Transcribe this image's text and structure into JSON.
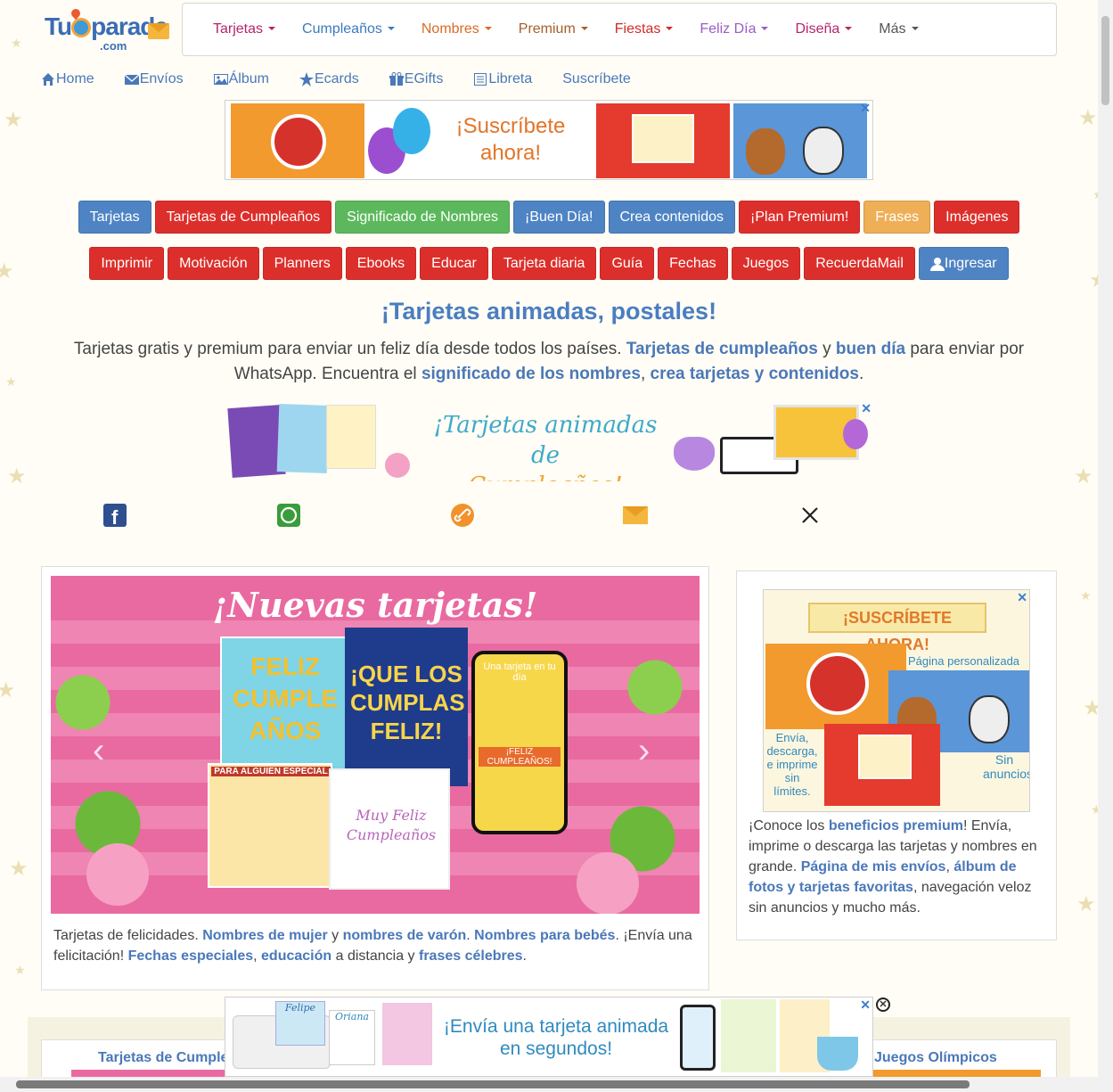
{
  "logo": {
    "text_a": "Tu",
    "text_b": "parada",
    "text_c": ".com"
  },
  "topnav": [
    {
      "label": "Tarjetas",
      "color": "#b4256e"
    },
    {
      "label": "Cumpleaños",
      "color": "#3b7bbf"
    },
    {
      "label": "Nombres",
      "color": "#d96a25"
    },
    {
      "label": "Premium",
      "color": "#a5602a"
    },
    {
      "label": "Fiestas",
      "color": "#d22b2b"
    },
    {
      "label": "Feliz Día",
      "color": "#9a5cc5"
    },
    {
      "label": "Diseña",
      "color": "#b4256e"
    },
    {
      "label": "Más",
      "color": "#555555"
    }
  ],
  "subnav": [
    {
      "label": "Home",
      "icon": "home-icon"
    },
    {
      "label": "Envíos",
      "icon": "envelope-icon"
    },
    {
      "label": "Álbum",
      "icon": "picture-icon"
    },
    {
      "label": "Ecards",
      "icon": "star-icon"
    },
    {
      "label": "EGifts",
      "icon": "gift-icon"
    },
    {
      "label": "Libreta",
      "icon": "notebook-icon"
    },
    {
      "label": "Suscríbete",
      "icon": ""
    }
  ],
  "ad_top": {
    "text": "¡Suscríbete ahora!",
    "close": "✕"
  },
  "buttons_row1": [
    {
      "label": "Tarjetas",
      "style": "blue"
    },
    {
      "label": "Tarjetas de Cumpleaños",
      "style": "red"
    },
    {
      "label": "Significado de Nombres",
      "style": "green"
    },
    {
      "label": "¡Buen Día!",
      "style": "blue"
    },
    {
      "label": "Crea contenidos",
      "style": "blue"
    },
    {
      "label": "¡Plan Premium!",
      "style": "red"
    },
    {
      "label": "Frases",
      "style": "orange"
    },
    {
      "label": "Imágenes",
      "style": "red"
    }
  ],
  "buttons_row2": [
    {
      "label": "Imprimir",
      "style": "red"
    },
    {
      "label": "Motivación",
      "style": "red"
    },
    {
      "label": "Planners",
      "style": "red"
    },
    {
      "label": "Ebooks",
      "style": "red"
    },
    {
      "label": "Educar",
      "style": "red"
    },
    {
      "label": "Tarjeta diaria",
      "style": "red"
    },
    {
      "label": "Guía",
      "style": "red"
    },
    {
      "label": "Fechas",
      "style": "red"
    },
    {
      "label": "Juegos",
      "style": "red"
    },
    {
      "label": "RecuerdaMail",
      "style": "red"
    },
    {
      "label": "Ingresar",
      "style": "blue",
      "icon": "user-icon"
    }
  ],
  "headline": "¡Tarjetas animadas, postales!",
  "intro": {
    "p1": "Tarjetas gratis y premium para enviar un feliz día desde todos los países. ",
    "l1": "Tarjetas de cumpleaños",
    "p2": " y ",
    "l2": "buen día",
    "p3": " para enviar por WhatsApp. Encuentra el ",
    "l3": "significado de los nombres",
    "p4": ", ",
    "l4": "crea tarjetas y contenidos",
    "p5": "."
  },
  "ad_mid": {
    "line1": "¡Tarjetas animadas de",
    "line2": "Cumpleaños!",
    "close": "✕"
  },
  "share": [
    "facebook-icon",
    "whatsapp-icon",
    "link-icon",
    "email-icon",
    "x-icon"
  ],
  "carousel": {
    "title": "¡Nuevas tarjetas!",
    "card1": "FELIZ CUMPLE AÑOS",
    "card2": "¡QUE LOS CUMPLAS FELIZ!",
    "phone_top": "Una tarjeta en tu día",
    "phone_mid": "¡FELIZ CUMPLEAÑOS!",
    "card3": "PARA ALGUIEN ESPECIAL",
    "card4": "Muy Feliz Cumpleaños"
  },
  "left_caption": {
    "p1": "Tarjetas de felicidades. ",
    "l1": "Nombres de mujer",
    "p2": " y ",
    "l2": "nombres de varón",
    "p3": ". ",
    "l3": "Nombres para bebés",
    "p4": ". ¡Envía una felicitación! ",
    "l4": "Fechas especiales",
    "p5": ", ",
    "l5": "educación",
    "p6": " a distancia y ",
    "l6": "frases célebres",
    "p7": "."
  },
  "side_ad": {
    "banner": "¡SUSCRÍBETE AHORA!",
    "page": "Página personalizada",
    "left_note": "Envía, descarga, e imprime sin límites.",
    "right_note": "Sin anuncios",
    "close": "✕"
  },
  "side_text": {
    "p1": "¡Conoce los ",
    "l1": "beneficios premium",
    "p2": "! Envía, imprime o descarga las tarjetas y nombres en grande. ",
    "l2": "Página de mis envíos",
    "p3": ", ",
    "l3": "álbum de fotos y tarjetas favoritas",
    "p4": ", navegación veloz sin anuncios y mucho más."
  },
  "ad_bottom": {
    "line1": "¡Envía una tarjeta animada",
    "line2": "en segundos!",
    "close": "✕",
    "card_name1": "Felipe",
    "card_name2": "Oriana"
  },
  "bottom_links": {
    "left": "Tarjetas de Cumple",
    "right": "Juegos Olímpicos"
  }
}
